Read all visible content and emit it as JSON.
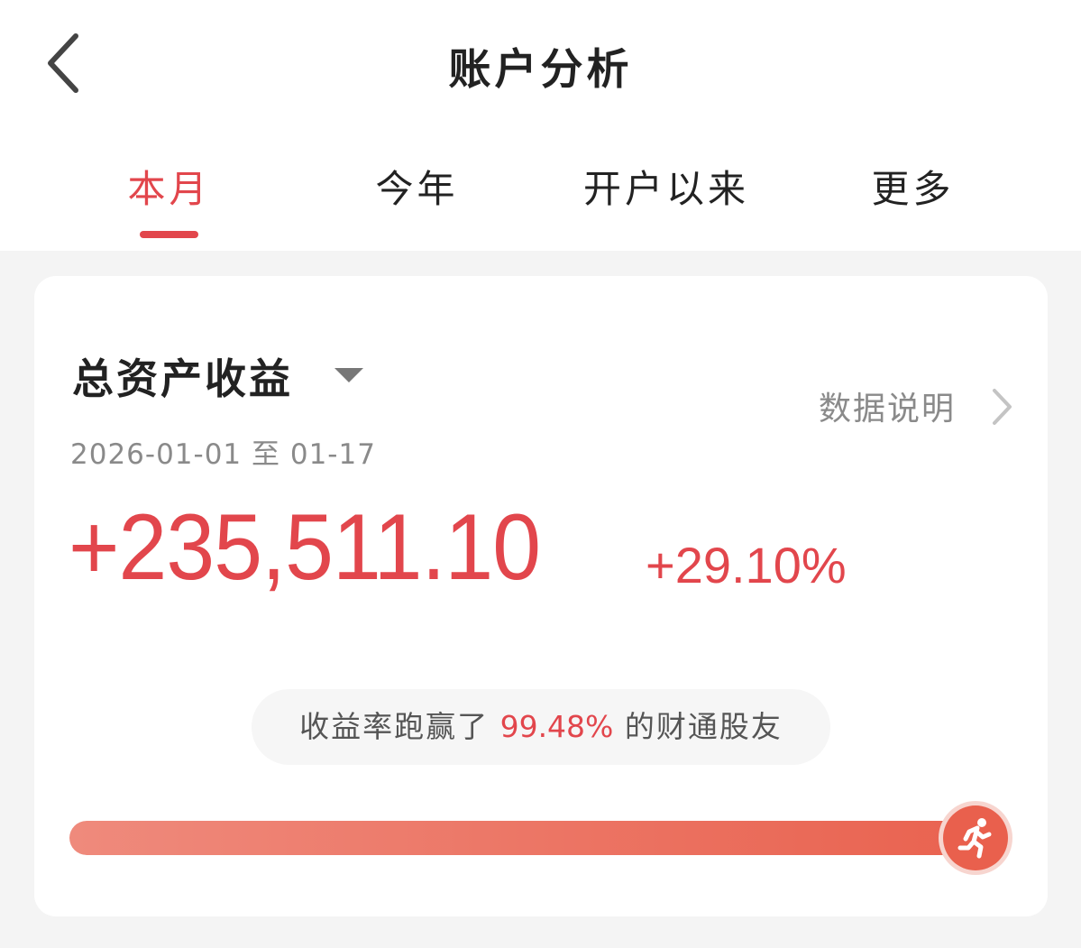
{
  "header": {
    "title": "账户分析",
    "back_icon": "chevron-left-icon"
  },
  "tabs": [
    {
      "label": "本月",
      "active": true
    },
    {
      "label": "今年",
      "active": false
    },
    {
      "label": "开户以来",
      "active": false
    },
    {
      "label": "更多",
      "active": false
    }
  ],
  "card": {
    "title": "总资产收益",
    "dropdown_icon": "caret-down-icon",
    "data_note": "数据说明",
    "date_range": "2026-01-01 至 01-17",
    "profit_amount": "+235,511.10",
    "profit_rate": "+29.10%",
    "rank": {
      "prefix": "收益率跑赢了",
      "percent": "99.48%",
      "suffix": "的财通股友"
    },
    "progress": 0.9948,
    "progress_icon": "runner-icon"
  },
  "colors": {
    "accent": "#e2464c",
    "bar_start": "#ef8a7c",
    "bar_end": "#e9624f"
  }
}
